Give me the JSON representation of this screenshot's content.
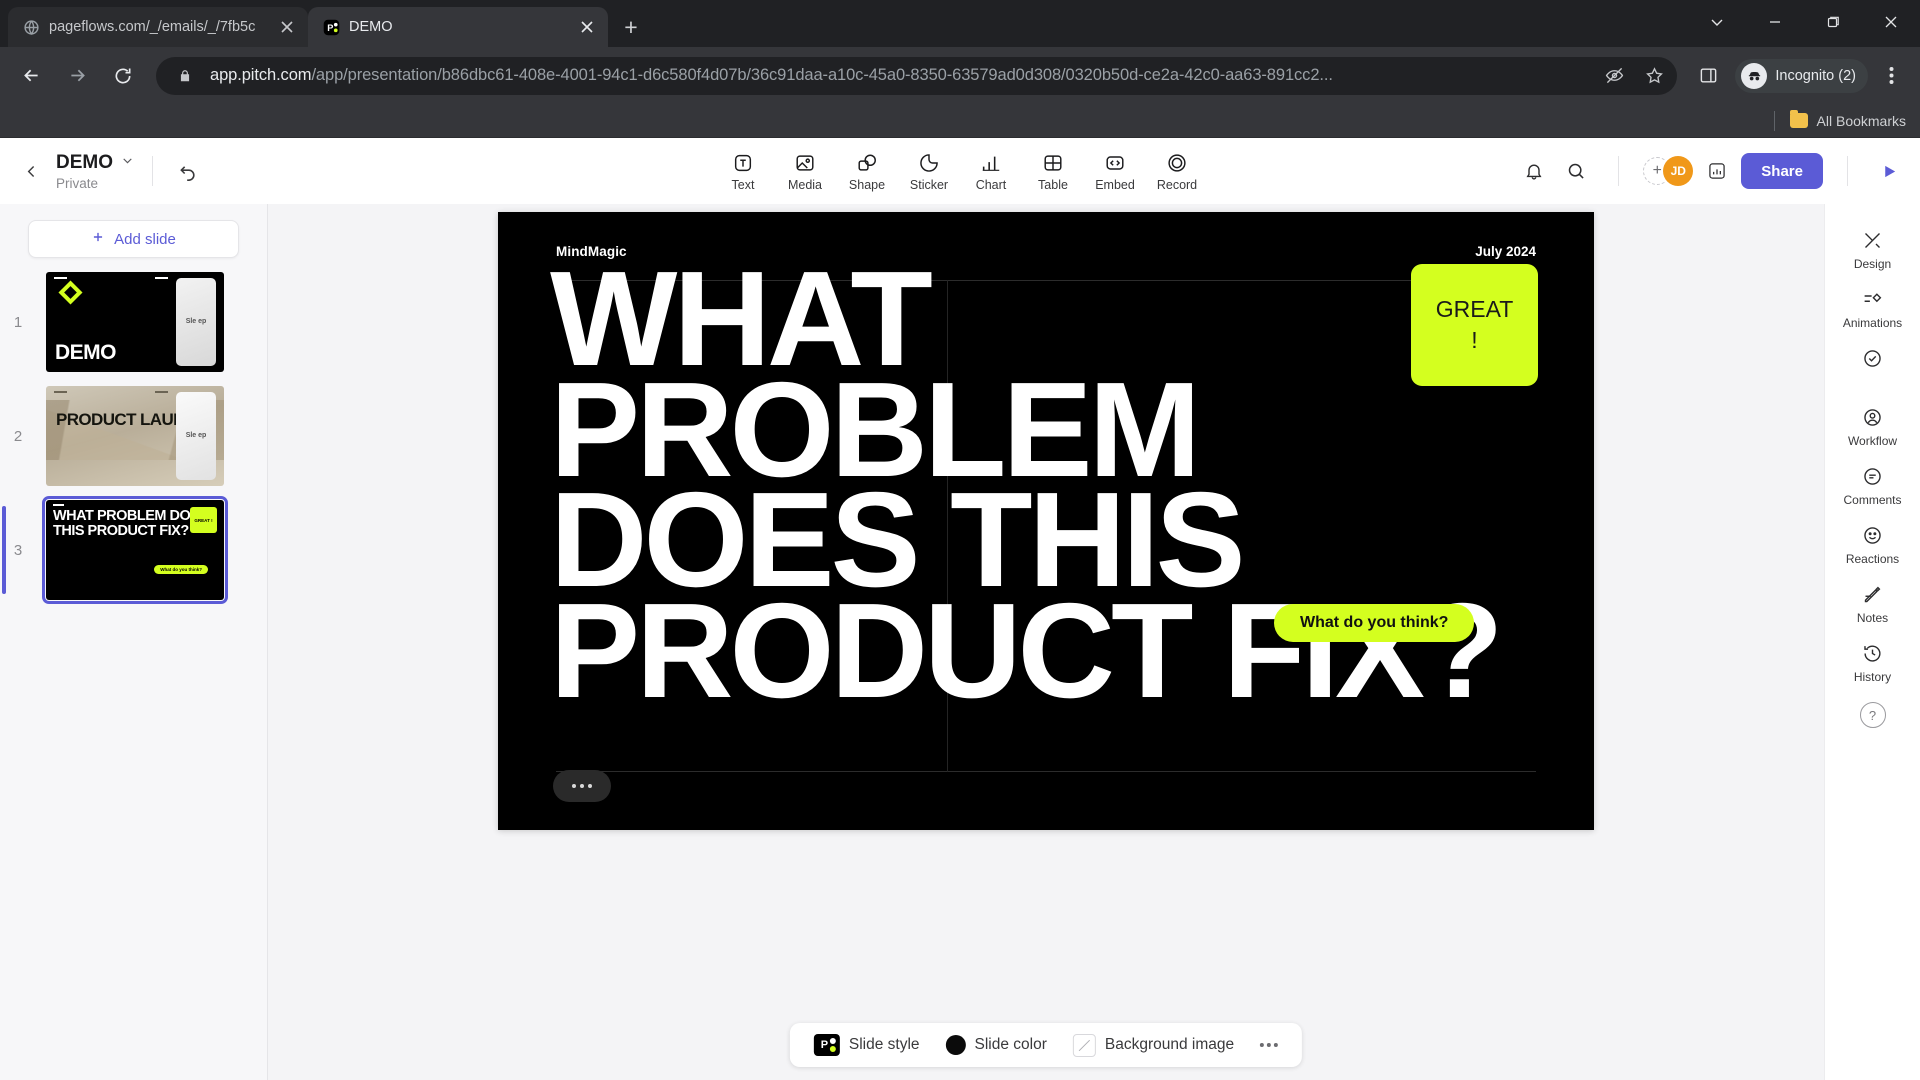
{
  "browser": {
    "tabs": [
      {
        "title": "pageflows.com/_/emails/_/7fb5c",
        "favicon": "globe-icon",
        "active": false
      },
      {
        "title": "DEMO",
        "favicon": "pitch-icon",
        "active": true
      }
    ],
    "new_tab_label": "+",
    "window_controls": {
      "minimize": "–",
      "maximize": "❐",
      "close": "✕",
      "tab_search": "⌄"
    },
    "omnibox": {
      "lock_icon": "lock-icon",
      "url_host": "app.pitch.com",
      "url_path": "/app/presentation/b86dbc61-408e-4001-94c1-d6c580f4d07b/36c91daa-a10c-45a0-8350-63579ad0d308/0320b50d-ce2a-42c0-aa63-891cc2...",
      "icons": [
        "eye-off-icon",
        "star-icon"
      ]
    },
    "toolbar_icons": [
      "side-panel-icon"
    ],
    "profile": {
      "label": "Incognito (2)",
      "icon": "incognito-icon"
    },
    "menu_icon": "kebab-menu-icon",
    "bookmarks": {
      "all_bookmarks_label": "All Bookmarks",
      "folder_icon": "folder-icon"
    }
  },
  "app": {
    "back_icon": "chevron-left-icon",
    "deck": {
      "title": "DEMO",
      "visibility": "Private",
      "chevron": "chevron-down-icon"
    },
    "undo_icon": "undo-icon",
    "tools": [
      {
        "label": "Text",
        "icon": "text-icon"
      },
      {
        "label": "Media",
        "icon": "media-icon"
      },
      {
        "label": "Shape",
        "icon": "shape-icon"
      },
      {
        "label": "Sticker",
        "icon": "sticker-icon"
      },
      {
        "label": "Chart",
        "icon": "chart-icon"
      },
      {
        "label": "Table",
        "icon": "table-icon"
      },
      {
        "label": "Embed",
        "icon": "embed-icon"
      },
      {
        "label": "Record",
        "icon": "record-icon"
      }
    ],
    "top_right": {
      "bell_icon": "bell-icon",
      "search_icon": "search-icon",
      "add_member_icon": "plus-icon",
      "avatar_initials": "JD",
      "analytics_icon": "analytics-icon",
      "share_label": "Share",
      "play_icon": "play-icon"
    },
    "sidebar": {
      "add_slide_label": "Add slide",
      "add_slide_icon": "plus-icon",
      "slides": [
        {
          "number": "1",
          "title": "DEMO",
          "selected": false,
          "phone_text": "Sle ep"
        },
        {
          "number": "2",
          "title": "PRODUCT LAUNCH",
          "selected": false,
          "phone_text": "Sle ep"
        },
        {
          "number": "3",
          "title": "WHAT PROBLEM DOES THIS PRODUCT FIX?",
          "selected": true,
          "note": "GREAT !",
          "pill": "What do you think?"
        }
      ]
    },
    "slide": {
      "brand": "MindMagic",
      "date": "July 2024",
      "headline": "WHAT PROBLEM DOES THIS PRODUCT FIX?",
      "sticky_note": {
        "line1": "GREAT",
        "line2": "!",
        "color": "#d4ff1f"
      },
      "reaction_pill": {
        "text": "What do you think?",
        "color": "#d4ff1f"
      },
      "more_icon": "more-dots-icon",
      "background_color": "#000000"
    },
    "bottom_bar": {
      "slide_style_label": "Slide style",
      "slide_color_label": "Slide color",
      "background_image_label": "Background image",
      "more_icon": "more-dots-icon",
      "slide_color_value": "#0b0b0b"
    },
    "right_rail": [
      {
        "label": "Design",
        "icon": "design-icon"
      },
      {
        "label": "Animations",
        "icon": "animations-icon"
      },
      {
        "label": "Workflow",
        "icon": "workflow-icon"
      },
      {
        "label": "Comments",
        "icon": "comments-icon"
      },
      {
        "label": "Reactions",
        "icon": "reactions-icon"
      },
      {
        "label": "Notes",
        "icon": "notes-icon"
      },
      {
        "label": "History",
        "icon": "history-icon"
      }
    ],
    "help_label": "?",
    "accent_color": "#5b5bd6"
  }
}
